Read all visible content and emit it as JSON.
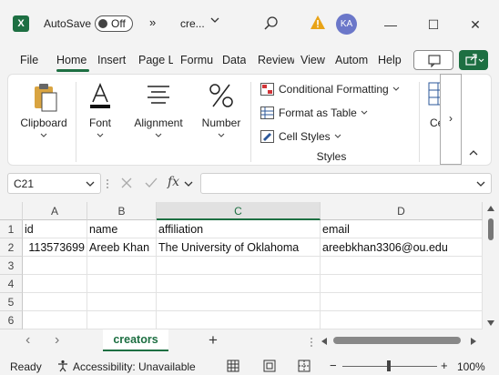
{
  "titlebar": {
    "app_logo": "X",
    "autosave_label": "AutoSave",
    "autosave_state": "Off",
    "more_glyph": "»",
    "doc_title": "cre...",
    "avatar_initials": "KA",
    "minimize": "—",
    "maximize": "☐",
    "close": "✕"
  },
  "tabs": [
    {
      "label": "File"
    },
    {
      "label": "Home"
    },
    {
      "label": "Insert"
    },
    {
      "label": "Page L"
    },
    {
      "label": "Formu"
    },
    {
      "label": "Data"
    },
    {
      "label": "Review"
    },
    {
      "label": "View"
    },
    {
      "label": "Autom"
    },
    {
      "label": "Help"
    }
  ],
  "ribbon": {
    "clipboard": "Clipboard",
    "font": "Font",
    "alignment": "Alignment",
    "number": "Number",
    "conditional_formatting": "Conditional Formatting",
    "format_as_table": "Format as Table",
    "cell_styles": "Cell Styles",
    "styles_group": "Styles",
    "cells_partial": "Ce",
    "scroll_glyph": "›",
    "collapse_glyph": "⌃"
  },
  "formula_bar": {
    "name_box": "C21",
    "fx": "fx",
    "formula": ""
  },
  "grid": {
    "columns": [
      "A",
      "B",
      "C",
      "D"
    ],
    "selected_column": "C",
    "rows": [
      {
        "num": "1",
        "cells": [
          "id",
          "name",
          "affiliation",
          "email"
        ]
      },
      {
        "num": "2",
        "cells": [
          "113573699",
          "Areeb Khan",
          "The University of Oklahoma",
          "areebkhan3306@ou.edu"
        ]
      },
      {
        "num": "3",
        "cells": [
          "",
          "",
          "",
          ""
        ]
      },
      {
        "num": "4",
        "cells": [
          "",
          "",
          "",
          ""
        ]
      },
      {
        "num": "5",
        "cells": [
          "",
          "",
          "",
          ""
        ]
      },
      {
        "num": "6",
        "cells": [
          "",
          "",
          "",
          ""
        ]
      }
    ]
  },
  "sheets": {
    "active": "creators",
    "add_glyph": "+",
    "prev_glyph": "‹",
    "next_glyph": "›"
  },
  "status": {
    "ready": "Ready",
    "accessibility": "Accessibility: Unavailable",
    "zoom": "100%",
    "zoom_minus": "−",
    "zoom_plus": "+"
  },
  "colors": {
    "brand": "#1d6f42",
    "warning": "#e8a317",
    "avatar": "#6b77c9"
  }
}
